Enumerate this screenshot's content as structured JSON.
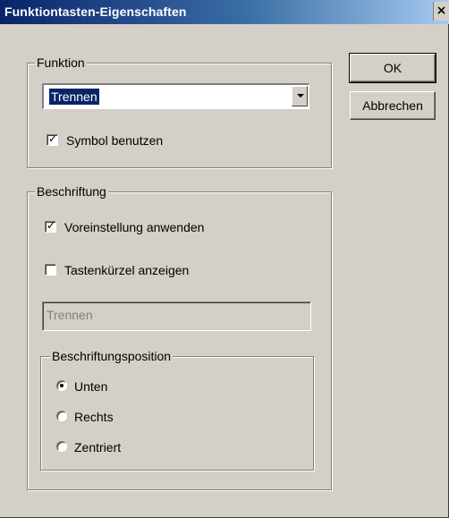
{
  "window": {
    "title": "Funktiontasten-Eigenschaften",
    "close_glyph": "×",
    "close_icon": "close-icon"
  },
  "buttons": {
    "ok_label": "OK",
    "cancel_label": "Abbrechen"
  },
  "funktion_group": {
    "legend": "Funktion",
    "combo_value": "Trennen",
    "combo_arrow_icon": "chevron-down-icon",
    "symbol_checkbox": {
      "label": "Symbol benutzen",
      "checked": true
    }
  },
  "beschriftung_group": {
    "legend": "Beschriftung",
    "voreinstellung_checkbox": {
      "label": "Voreinstellung anwenden",
      "checked": true
    },
    "tastenkuerzel_checkbox": {
      "label": "Tastenkürzel anzeigen",
      "checked": false
    },
    "text_field_value": "Trennen",
    "position_group": {
      "legend": "Beschriftungsposition",
      "options": [
        {
          "label": "Unten",
          "selected": true
        },
        {
          "label": "Rechts",
          "selected": false
        },
        {
          "label": "Zentriert",
          "selected": false
        }
      ]
    }
  },
  "colors": {
    "title_bar_start": "#0a246a",
    "title_bar_end": "#a6caf0",
    "dialog_bg": "#d4d0c8",
    "selection": "#0a246a"
  }
}
